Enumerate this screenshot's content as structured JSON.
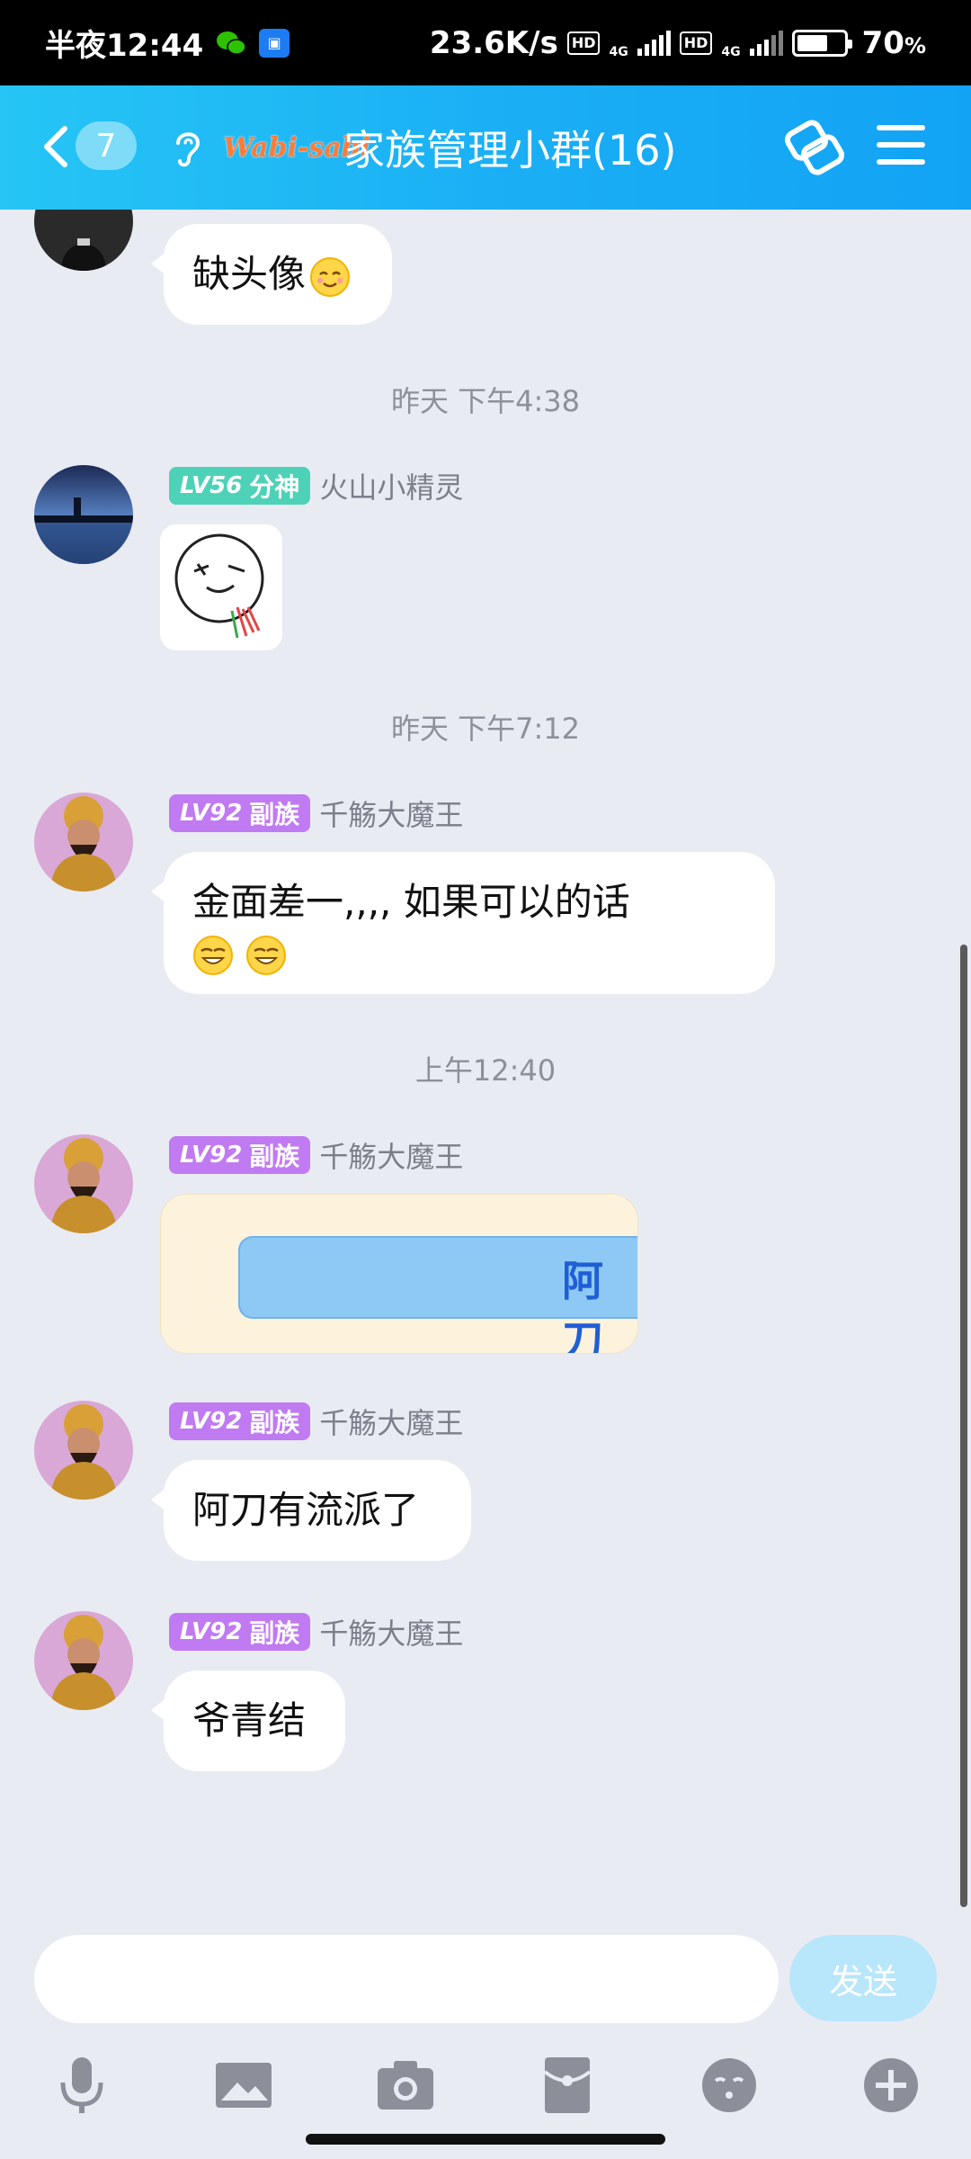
{
  "status_bar": {
    "time": "半夜12:44",
    "net_speed": "23.6K/s",
    "network_label": "4G",
    "hd_label": "HD",
    "battery": "70",
    "battery_unit": "%",
    "battery_level": 0.7
  },
  "header": {
    "unread_count": "7",
    "brand_text": "Wabi-sabi",
    "title": "家族管理小群(16)"
  },
  "messages": [
    {
      "type": "text",
      "content": "缺头像",
      "emoji": "smile-emoji"
    },
    {
      "type": "time",
      "content": "昨天 下午4:38"
    },
    {
      "type": "sticker",
      "level": "LV56",
      "title": "分神",
      "nickname": "火山小精灵"
    },
    {
      "type": "time",
      "content": "昨天 下午7:12"
    },
    {
      "type": "text",
      "level": "LV92",
      "title": "副族",
      "nickname": "千觞大魔王",
      "content": "金面差一,,,, 如果可以的话",
      "emoji": "grin-emoji"
    },
    {
      "type": "time",
      "content": "上午12:40"
    },
    {
      "type": "image",
      "level": "LV92",
      "title": "副族",
      "nickname": "千觞大魔王",
      "content": "阿刀"
    },
    {
      "type": "text",
      "level": "LV92",
      "title": "副族",
      "nickname": "千觞大魔王",
      "content": "阿刀有流派了"
    },
    {
      "type": "text",
      "level": "LV92",
      "title": "副族",
      "nickname": "千觞大魔王",
      "content": "爷青结"
    }
  ],
  "input": {
    "placeholder": "",
    "send_label": "发送"
  },
  "toolbar": {
    "icons": [
      "microphone-icon",
      "picture-icon",
      "camera-icon",
      "red-packet-icon",
      "emoji-icon",
      "plus-icon"
    ]
  },
  "colors": {
    "header": "#1aaef5",
    "background": "#e9ebf3",
    "badge_green": "#4ed2b7",
    "badge_purple": "#c07af2",
    "send_disabled": "#b8e6fa"
  }
}
